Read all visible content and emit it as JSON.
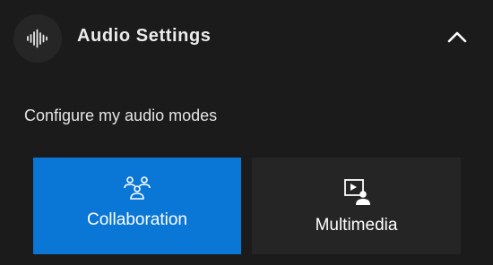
{
  "header": {
    "title": "Audio Settings",
    "icon": "waveform-icon",
    "toggle_icon": "chevron-up-icon"
  },
  "subtitle": "Configure my audio modes",
  "modes": [
    {
      "label": "Collaboration",
      "icon": "people-group-icon",
      "selected": true
    },
    {
      "label": "Multimedia",
      "icon": "media-person-icon",
      "selected": false
    }
  ],
  "colors": {
    "background": "#1b1b1b",
    "selected": "#0a76d6",
    "unselected": "#252525"
  }
}
